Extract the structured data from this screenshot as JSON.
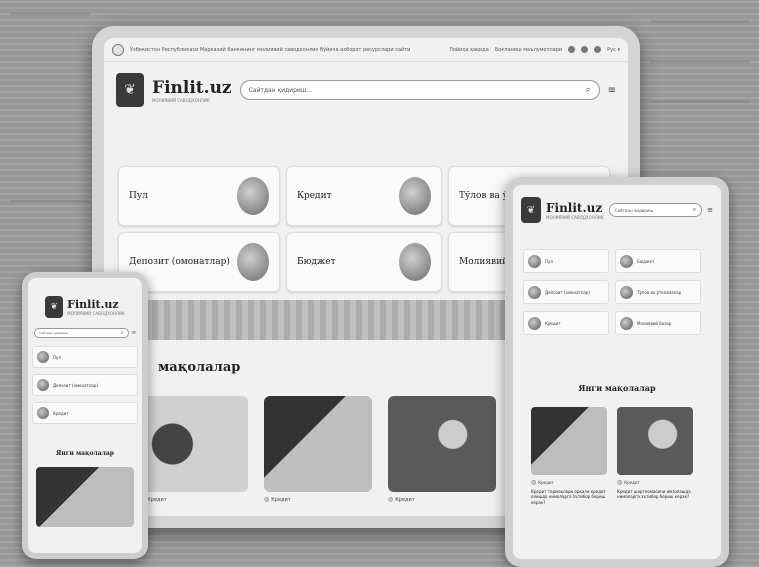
{
  "laptop": {
    "topbar": {
      "gov_text": "Ўзбекистон Республикаси Марказий банкининг молиявий саводхонлик бўйича ахборот ресурслари сайти",
      "link1": "Лойиҳа ҳақида",
      "link2": "Боғланиш маълумотлари",
      "lang": "Рус ▾"
    },
    "logo": {
      "title": "Finlit.uz",
      "subtitle": "МОЛИЯВИЙ САВОДХОНЛИК"
    },
    "search": {
      "placeholder": "Сайтдан қидириш..."
    },
    "categories": [
      {
        "label": "Пул"
      },
      {
        "label": "Кредит"
      },
      {
        "label": "Тўлов ва ўтка"
      },
      {
        "label": "Депозит (омонатлар)"
      },
      {
        "label": "Бюджет"
      },
      {
        "label": "Молиявий б"
      }
    ],
    "articles_title": "мақолалар",
    "articles": [
      {
        "tag": "Кредит"
      },
      {
        "tag": "Кредит"
      },
      {
        "tag": "Кредит"
      }
    ]
  },
  "tablet": {
    "logo": {
      "title": "Finlit.uz",
      "subtitle": "МОЛИЯВИЙ САВОДХОНЛИК"
    },
    "search": {
      "placeholder": "Сайтдан қидириш"
    },
    "categories": [
      {
        "label": "Пул"
      },
      {
        "label": "Бюджет"
      },
      {
        "label": "Депозит (омонатлар)"
      },
      {
        "label": "Тўлов ва ўтказмалар"
      },
      {
        "label": "Кредит"
      },
      {
        "label": "Молиявий бозор"
      }
    ],
    "articles_title": "Янги мақолалар",
    "articles": [
      {
        "tag": "Кредит",
        "desc": "Кредит тармоқлари орқали кредит олишда нималарга эътибор бериш керак?"
      },
      {
        "tag": "Кредит",
        "desc": "Кредит шартномасини имзолашда нималарга эътибор бериш керак?"
      }
    ]
  },
  "phone": {
    "logo": {
      "title": "Finlit.uz",
      "subtitle": "МОЛИЯВИЙ САВОДХОНЛИК"
    },
    "search": {
      "placeholder": "Сайтдан қидириш"
    },
    "categories": [
      {
        "label": "Пул"
      },
      {
        "label": "Депозит (омонатлар)"
      },
      {
        "label": "Кредит"
      }
    ],
    "articles_title": "Янги мақолалар"
  }
}
